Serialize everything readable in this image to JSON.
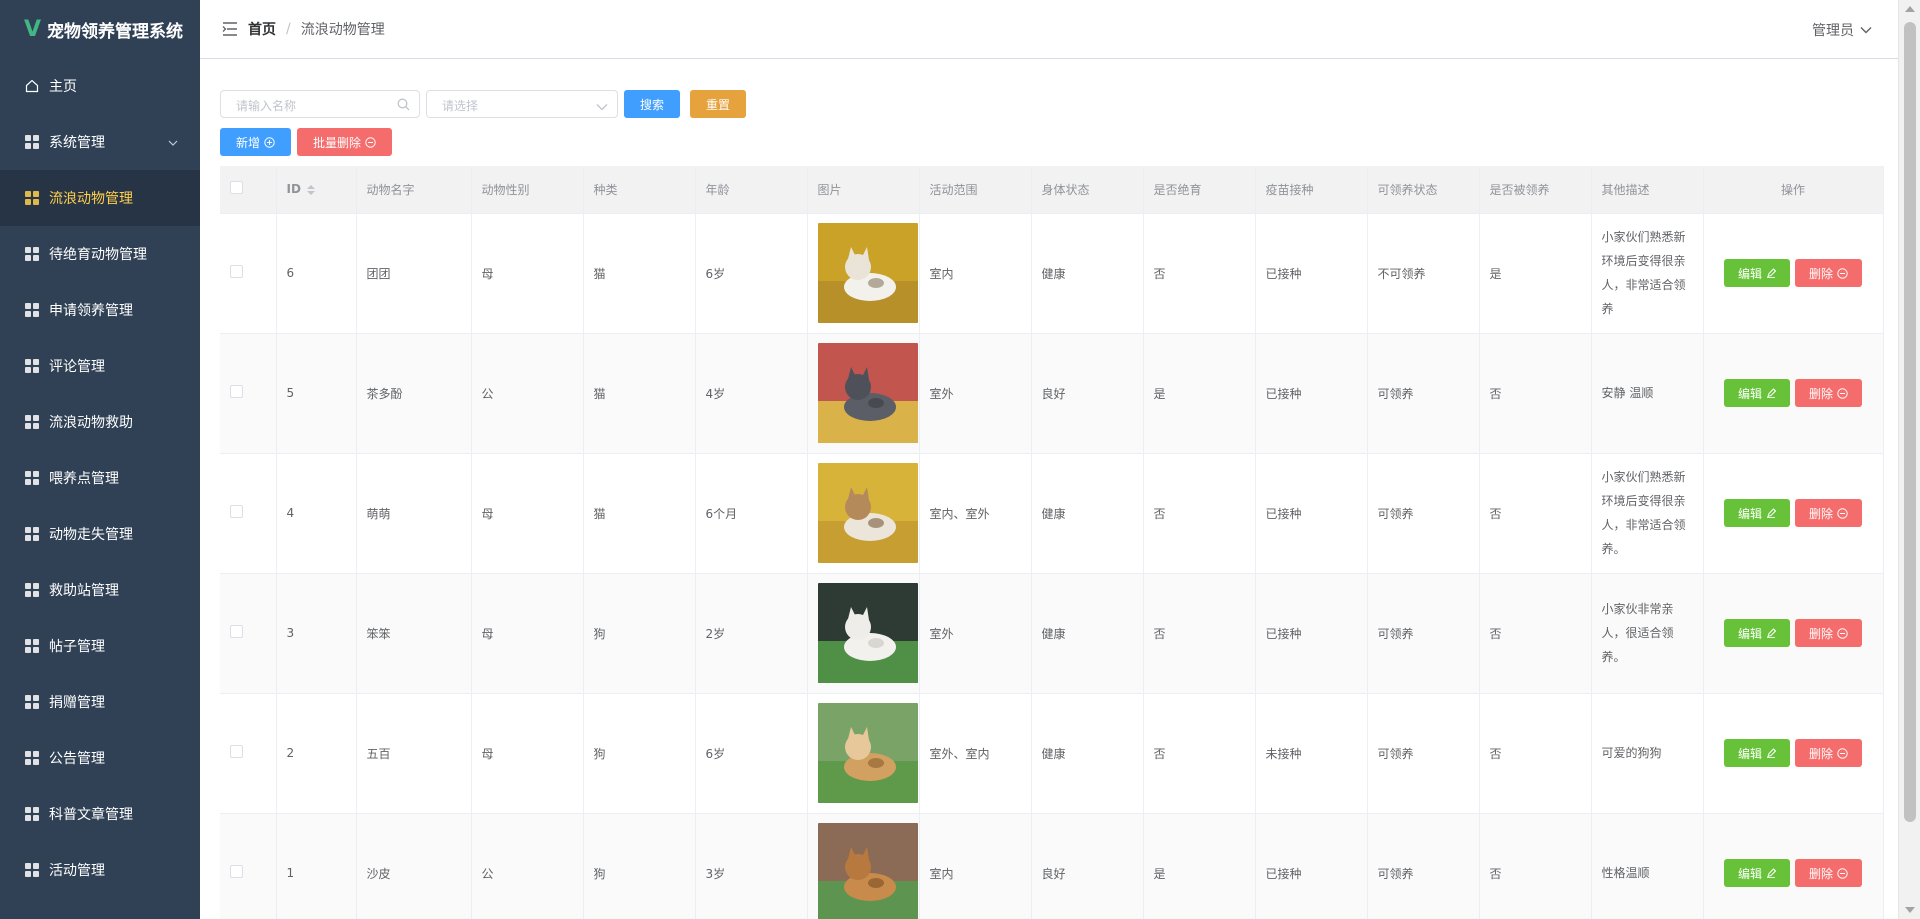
{
  "app": {
    "title": "宠物领养管理系统",
    "logo_letter": "V"
  },
  "sidebar": {
    "items": [
      {
        "label": "主页",
        "icon": "home-icon",
        "active": false
      },
      {
        "label": "系统管理",
        "icon": "grid-icon",
        "active": false,
        "has_arrow": true
      },
      {
        "label": "流浪动物管理",
        "icon": "grid-icon",
        "active": true
      },
      {
        "label": "待绝育动物管理",
        "icon": "grid-icon",
        "active": false
      },
      {
        "label": "申请领养管理",
        "icon": "grid-icon",
        "active": false
      },
      {
        "label": "评论管理",
        "icon": "grid-icon",
        "active": false
      },
      {
        "label": "流浪动物救助",
        "icon": "grid-icon",
        "active": false
      },
      {
        "label": "喂养点管理",
        "icon": "grid-icon",
        "active": false
      },
      {
        "label": "动物走失管理",
        "icon": "grid-icon",
        "active": false
      },
      {
        "label": "救助站管理",
        "icon": "grid-icon",
        "active": false
      },
      {
        "label": "帖子管理",
        "icon": "grid-icon",
        "active": false
      },
      {
        "label": "捐赠管理",
        "icon": "grid-icon",
        "active": false
      },
      {
        "label": "公告管理",
        "icon": "grid-icon",
        "active": false
      },
      {
        "label": "科普文章管理",
        "icon": "grid-icon",
        "active": false
      },
      {
        "label": "活动管理",
        "icon": "grid-icon",
        "active": false
      }
    ]
  },
  "header": {
    "breadcrumb_home": "首页",
    "breadcrumb_sep": "/",
    "breadcrumb_current": "流浪动物管理",
    "user": "管理员"
  },
  "filters": {
    "name_placeholder": "请输入名称",
    "select_placeholder": "请选择",
    "search_label": "搜索",
    "reset_label": "重置"
  },
  "actions": {
    "add_label": "新增",
    "batch_delete_label": "批量删除"
  },
  "table": {
    "columns": [
      "ID",
      "动物名字",
      "动物性别",
      "种类",
      "年龄",
      "图片",
      "活动范围",
      "身体状态",
      "是否绝育",
      "疫苗接种",
      "可领养状态",
      "是否被领养",
      "其他描述",
      "操作"
    ],
    "edit_label": "编辑",
    "delete_label": "删除",
    "rows": [
      {
        "id": "6",
        "name": "团团",
        "gender": "母",
        "kind": "猫",
        "age": "6岁",
        "photo": "cat-white-on-yellow",
        "range": "室内",
        "health": "健康",
        "neutered": "否",
        "vaccine": "已接种",
        "adoptable": "不可领养",
        "adopted": "是",
        "desc": "小家伙们熟悉新环境后变得很亲人，非常适合领养"
      },
      {
        "id": "5",
        "name": "茶多酚",
        "gender": "公",
        "kind": "猫",
        "age": "4岁",
        "photo": "cat-grey-on-red",
        "range": "室外",
        "health": "良好",
        "neutered": "是",
        "vaccine": "已接种",
        "adoptable": "可领养",
        "adopted": "否",
        "desc": "安静 温顺"
      },
      {
        "id": "4",
        "name": "萌萌",
        "gender": "母",
        "kind": "猫",
        "age": "6个月",
        "photo": "cat-tabby-on-yellow",
        "range": "室内、室外",
        "health": "健康",
        "neutered": "否",
        "vaccine": "已接种",
        "adoptable": "可领养",
        "adopted": "否",
        "desc": "小家伙们熟悉新环境后变得很亲人，非常适合领养。"
      },
      {
        "id": "3",
        "name": "笨笨",
        "gender": "母",
        "kind": "狗",
        "age": "2岁",
        "photo": "dog-white-on-grass",
        "range": "室外",
        "health": "健康",
        "neutered": "否",
        "vaccine": "已接种",
        "adoptable": "可领养",
        "adopted": "否",
        "desc": "小家伙非常亲人，很适合领养。"
      },
      {
        "id": "2",
        "name": "五百",
        "gender": "母",
        "kind": "狗",
        "age": "6岁",
        "photo": "dog-tan-on-grass",
        "range": "室外、室内",
        "health": "健康",
        "neutered": "否",
        "vaccine": "未接种",
        "adoptable": "可领养",
        "adopted": "否",
        "desc": "可爱的狗狗"
      },
      {
        "id": "1",
        "name": "沙皮",
        "gender": "公",
        "kind": "狗",
        "age": "3岁",
        "photo": "dog-brown-on-grass",
        "range": "室内",
        "health": "良好",
        "neutered": "是",
        "vaccine": "已接种",
        "adoptable": "可领养",
        "adopted": "否",
        "desc": "性格温顺"
      }
    ]
  },
  "colors": {
    "sidebar_bg": "#304156",
    "sidebar_active_bg": "#263445",
    "sidebar_active_text": "#ffd04b",
    "primary": "#409eff",
    "warning": "#e6a23c",
    "danger": "#f56c6c",
    "success": "#67c23a"
  }
}
